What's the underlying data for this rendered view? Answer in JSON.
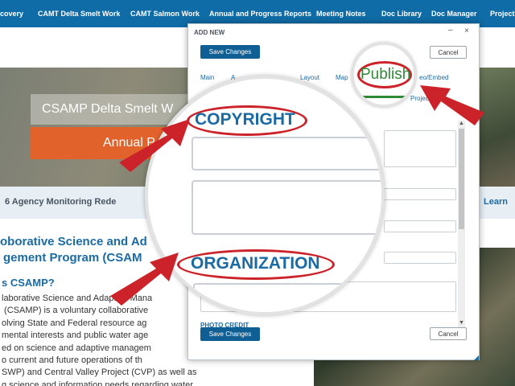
{
  "nav": {
    "items": [
      "covery",
      "CAMT Delta Smelt Work",
      "CAMT Salmon Work",
      "Annual and Progress Reports",
      "Meeting Notes",
      "Doc Library",
      "Doc Manager",
      "Projects"
    ]
  },
  "page": {
    "hero_title": "CSAMP Delta Smelt W",
    "hero_subtitle": "Annual P",
    "strip_left": "6 Agency Monitoring Rede",
    "strip_right": "Learn",
    "heading_line1": "oborative Science and Ad",
    "heading_line2": "gement  Program (CSAM",
    "subheading": "s CSAMP?",
    "paragraph": "laborative Science and Adaptive Mana\n (CSAMP) is a voluntary collaborative\nolving State and Federal resource ag\nmental interests and public water age\ned on science and adaptive managem\no current and future operations of th\nSWP) and Central Valley Project (CVP) as well as\ng science and information needs regarding water"
  },
  "modal": {
    "title": "ADD NEW",
    "minimize": "–",
    "close": "×",
    "save_label": "Save Changes",
    "cancel_label": "Cancel",
    "tabs": [
      "Main",
      "A",
      "Layout",
      "Map",
      "eo/Embed",
      "Projec"
    ],
    "photo_credit_label": "PHOTO CREDIT"
  },
  "magnifier": {
    "copyright_label": "COPYRIGHT",
    "organization_label": "ORGANIZATION",
    "publish_label": "Publish"
  },
  "colors": {
    "nav_bg": "#0f6ca6",
    "accent_blue": "#1a6aa3",
    "highlight_red": "#cc2229",
    "publish_green": "#2e8a35",
    "hero_orange": "#e2622b"
  }
}
